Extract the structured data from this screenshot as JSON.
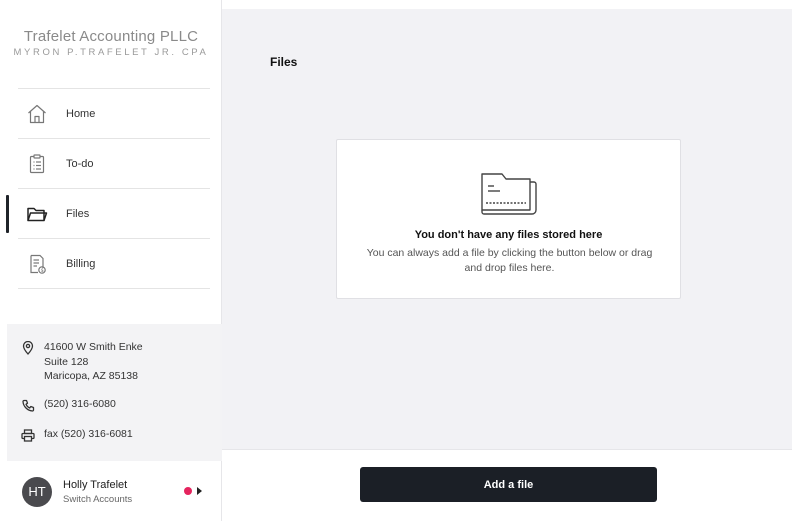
{
  "brand": {
    "name": "Trafelet Accounting PLLC",
    "subtitle": "MYRON P.TRAFELET JR. CPA"
  },
  "nav": {
    "items": [
      {
        "label": "Home",
        "icon": "home-icon"
      },
      {
        "label": "To-do",
        "icon": "clipboard-icon"
      },
      {
        "label": "Files",
        "icon": "folder-icon",
        "active": true
      },
      {
        "label": "Billing",
        "icon": "invoice-icon"
      }
    ]
  },
  "contact": {
    "address_line1": "41600 W Smith Enke",
    "address_line2": "Suite 128",
    "address_line3": "Maricopa, AZ 85138",
    "phone": "(520) 316-6080",
    "fax": "fax (520) 316-6081"
  },
  "account": {
    "initials": "HT",
    "name": "Holly Trafelet",
    "switch_label": "Switch Accounts",
    "notification_color": "#e5245e"
  },
  "main": {
    "title": "Files",
    "empty_title": "You don't have any files stored here",
    "empty_description": "You can always add a file by clicking the button below or drag and drop files here."
  },
  "actions": {
    "add_file_label": "Add a file"
  },
  "colors": {
    "accent_dark": "#1b1f26",
    "main_bg": "#f2f2f5"
  }
}
